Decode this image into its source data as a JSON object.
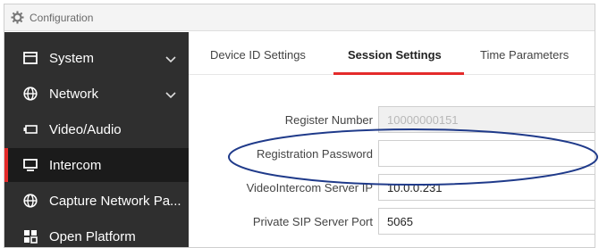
{
  "window": {
    "title": "Configuration",
    "icon": "gear-icon"
  },
  "sidebar": {
    "items": [
      {
        "label": "System",
        "icon": "monitor-icon",
        "expandable": true
      },
      {
        "label": "Network",
        "icon": "globe-icon",
        "expandable": true
      },
      {
        "label": "Video/Audio",
        "icon": "camera-icon",
        "expandable": false
      },
      {
        "label": "Intercom",
        "icon": "screen-icon",
        "expandable": false,
        "active": true
      },
      {
        "label": "Capture Network Pa...",
        "icon": "globe-icon",
        "expandable": false
      },
      {
        "label": "Open Platform",
        "icon": "grid-icon",
        "expandable": false
      }
    ]
  },
  "tabs": [
    {
      "label": "Device ID Settings"
    },
    {
      "label": "Session Settings",
      "active": true
    },
    {
      "label": "Time Parameters"
    }
  ],
  "form": {
    "register_number": {
      "label": "Register Number",
      "value": "10000000151",
      "disabled": true
    },
    "registration_password": {
      "label": "Registration Password",
      "value": ""
    },
    "videointercom_server_ip": {
      "label": "VideoIntercom Server IP",
      "value": "10.0.0.231"
    },
    "private_sip_server_port": {
      "label": "Private SIP Server Port",
      "value": "5065"
    }
  },
  "colors": {
    "accent": "#e42b2b",
    "sidebar_bg": "#2f2f2f",
    "sidebar_active": "#1b1b1b",
    "annotation": "#1f3a8a"
  }
}
